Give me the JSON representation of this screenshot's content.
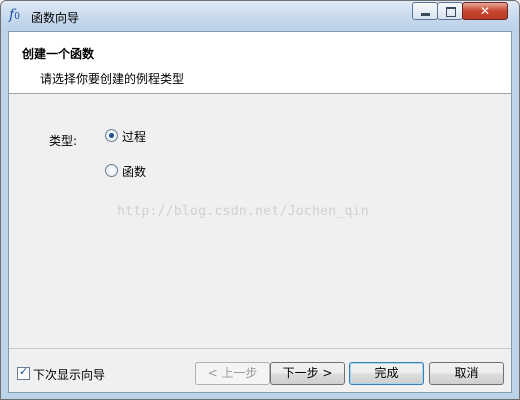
{
  "window": {
    "title": "函数向导",
    "app_icon": "function-icon",
    "caption_buttons": {
      "minimize": "minimize-icon",
      "maximize": "maximize-icon",
      "close": "close-icon",
      "close_glyph": "✕"
    }
  },
  "header": {
    "title": "创建一个函数",
    "subtitle": "请选择你要创建的例程类型"
  },
  "form": {
    "type_label": "类型:",
    "options": [
      {
        "label": "过程",
        "selected": true
      },
      {
        "label": "函数",
        "selected": false
      }
    ]
  },
  "watermark": "http://blog.csdn.net/Jochen_qin",
  "footer": {
    "checkbox_label": "下次显示向导",
    "checkbox_checked": true,
    "check_glyph": "✓",
    "buttons": {
      "back": "< 上一步",
      "next": "下一步 >",
      "finish": "完成",
      "cancel": "取消"
    }
  }
}
